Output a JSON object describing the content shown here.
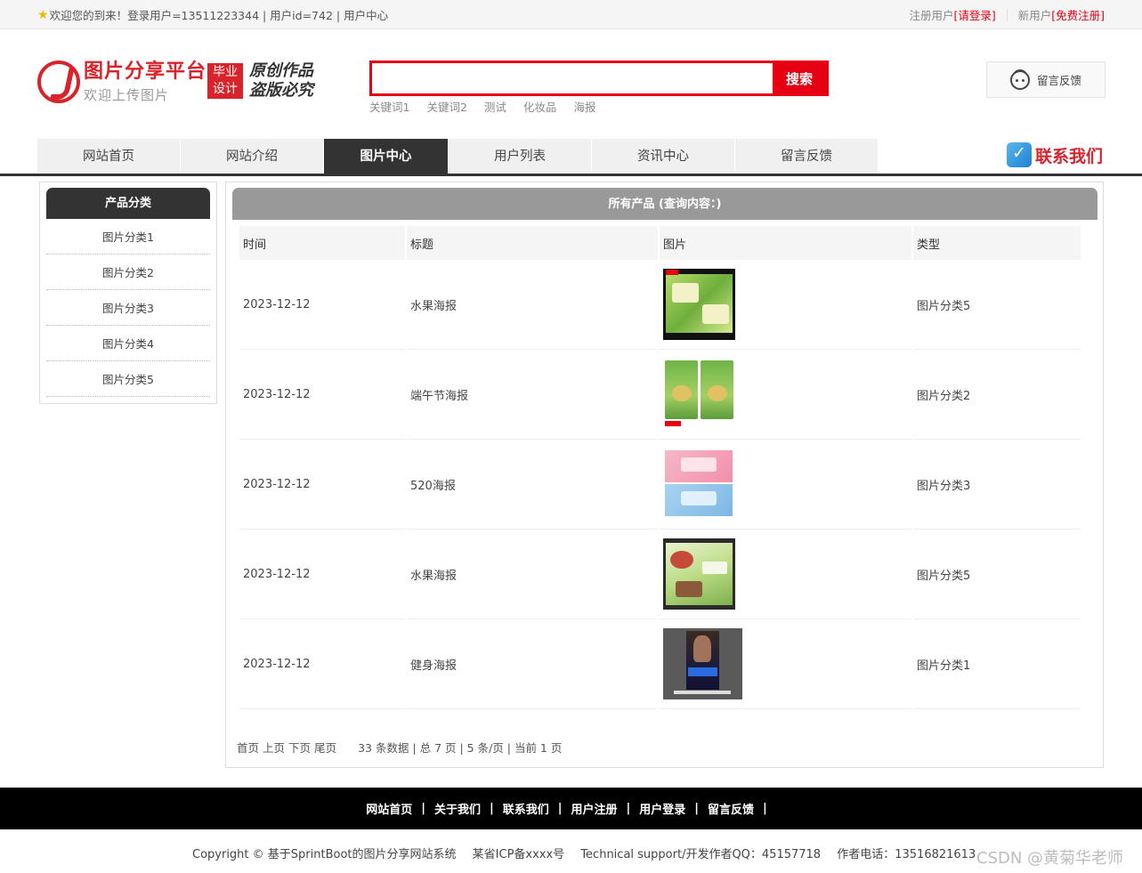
{
  "topbar": {
    "welcome": "欢迎您的到来！登录用户=13511223344 | 用户id=742 | 用户中心",
    "register_prefix": "注册用户",
    "login_link": "[请登录]",
    "new_user_prefix": "新用户",
    "free_register_link": "[免费注册]"
  },
  "header": {
    "logo_title": "图片分享平台",
    "logo_subtitle": "欢迎上传图片",
    "badge_line1": "毕业",
    "badge_line2": "设计",
    "slogan_line1": "原创作品",
    "slogan_line2": "盗版必究",
    "search_placeholder": "",
    "search_button": "搜索",
    "keywords": [
      "关键词1",
      "关键词2",
      "测试",
      "化妆品",
      "海报"
    ],
    "feedback_button": "留言反馈"
  },
  "nav": {
    "items": [
      "网站首页",
      "网站介绍",
      "图片中心",
      "用户列表",
      "资讯中心",
      "留言反馈"
    ],
    "active_index": 2,
    "contact": "联系我们"
  },
  "sidebar": {
    "title": "产品分类",
    "items": [
      "图片分类1",
      "图片分类2",
      "图片分类3",
      "图片分类4",
      "图片分类5"
    ]
  },
  "main": {
    "title": "所有产品 (查询内容：)",
    "columns": [
      "时间",
      "标题",
      "图片",
      "类型"
    ],
    "rows": [
      {
        "time": "2023-12-12",
        "title": "水果海报",
        "image": "fruit-poster-thumb",
        "type": "图片分类5"
      },
      {
        "time": "2023-12-12",
        "title": "端午节海报",
        "image": "dragon-boat-poster-thumb",
        "type": "图片分类2"
      },
      {
        "time": "2023-12-12",
        "title": "520海报",
        "image": "520-poster-thumb",
        "type": "图片分类3"
      },
      {
        "time": "2023-12-12",
        "title": "水果海报",
        "image": "fruit-poster-thumb-2",
        "type": "图片分类5"
      },
      {
        "time": "2023-12-12",
        "title": "健身海报",
        "image": "fitness-poster-thumb",
        "type": "图片分类1"
      }
    ],
    "pager": {
      "first": "首页",
      "prev": "上页",
      "next": "下页",
      "last": "尾页",
      "info": "33 条数据 | 总 7 页 | 5 条/页 | 当前 1 页"
    }
  },
  "footer": {
    "links": [
      "网站首页",
      "关于我们",
      "联系我们",
      "用户注册",
      "用户登录",
      "留言反馈"
    ],
    "copyright": "Copyright © 基于SprintBoot的图片分享网站系统",
    "icp": "某省ICP备xxxx号",
    "support": "Technical support/开发作者QQ：45157718",
    "phone": "作者电话：13516821613",
    "watermark": "CSDN @黄菊华老师"
  }
}
